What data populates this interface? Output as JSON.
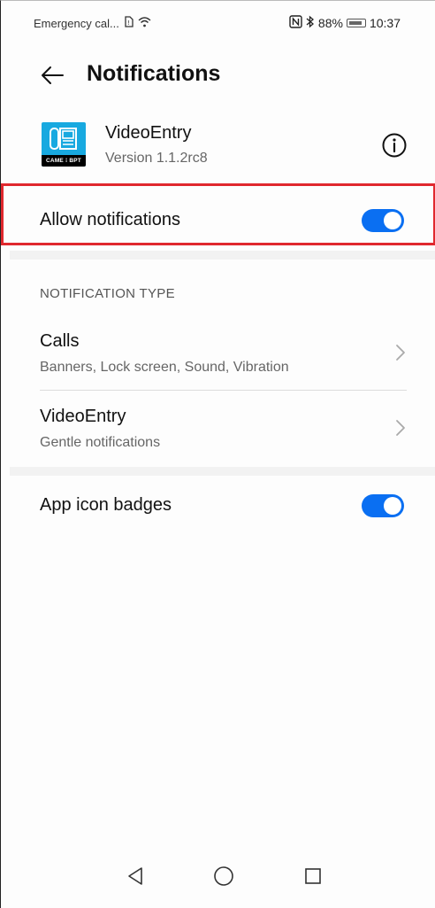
{
  "status_bar": {
    "left_text": "Emergency cal...",
    "battery_percent": "88%",
    "time": "10:37",
    "icons": [
      "sim-card-icon",
      "wifi-icon",
      "nfc-icon",
      "bluetooth-icon",
      "battery-icon"
    ]
  },
  "header": {
    "title": "Notifications",
    "back_icon": "arrow-left-icon"
  },
  "app": {
    "name": "VideoEntry",
    "version": "Version 1.1.2rc8",
    "icon_caption": "CAME ⁞ BPT",
    "info_icon": "info-icon"
  },
  "allow_notifications": {
    "label": "Allow notifications",
    "enabled": true
  },
  "notification_type": {
    "section_title": "NOTIFICATION TYPE",
    "items": [
      {
        "title": "Calls",
        "subtitle": "Banners, Lock screen, Sound, Vibration"
      },
      {
        "title": "VideoEntry",
        "subtitle": "Gentle notifications"
      }
    ]
  },
  "app_icon_badges": {
    "label": "App icon badges",
    "enabled": true
  },
  "colors": {
    "accent": "#0a6ff2",
    "highlight": "#e0282e",
    "app_icon_bg": "#18a9e0"
  },
  "nav_bar": {
    "buttons": [
      "back-triangle-icon",
      "home-circle-icon",
      "recents-square-icon"
    ]
  }
}
